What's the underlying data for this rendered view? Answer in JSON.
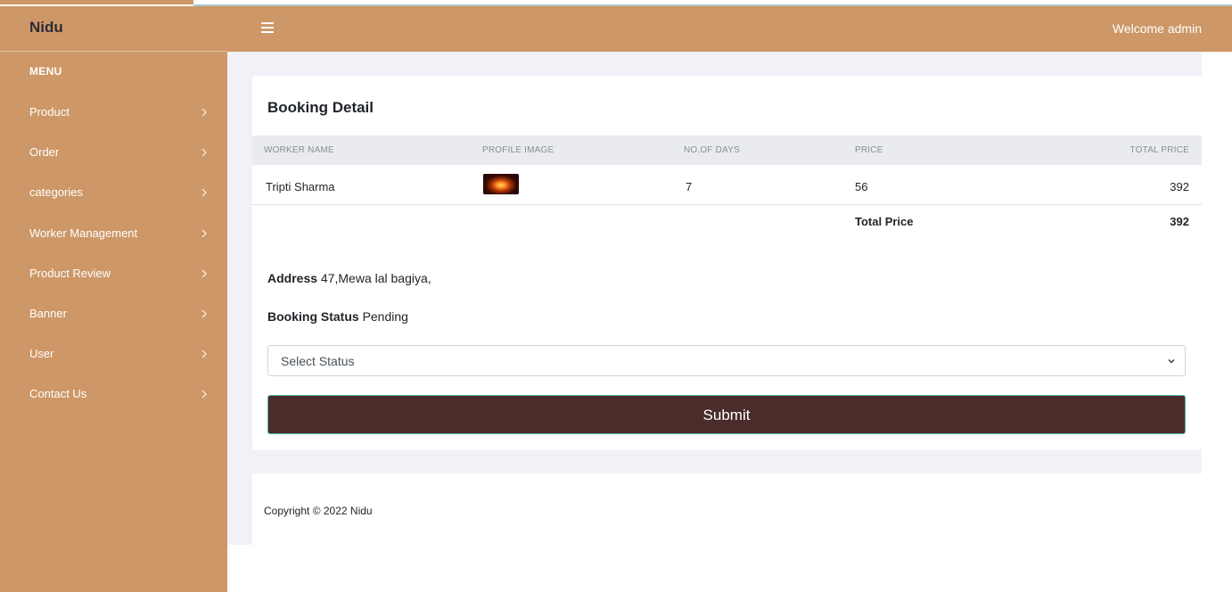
{
  "header": {
    "brand": "Nidu",
    "welcome": "Welcome admin"
  },
  "sidebar": {
    "menu_title": "MENU",
    "items": [
      {
        "label": "Product"
      },
      {
        "label": "Order"
      },
      {
        "label": "categories"
      },
      {
        "label": "Worker Management"
      },
      {
        "label": "Product Review"
      },
      {
        "label": "Banner"
      },
      {
        "label": "User"
      },
      {
        "label": "Contact Us"
      }
    ]
  },
  "booking": {
    "title": "Booking Detail",
    "columns": [
      "WORKER NAME",
      "PROFILE IMAGE",
      "NO.OF DAYS",
      "PRICE",
      "TOTAL PRICE"
    ],
    "rows": [
      {
        "worker_name": "Tripti Sharma",
        "profile_image": "profile-thumbnail",
        "days": "7",
        "price": "56",
        "total_price": "392"
      }
    ],
    "total_label": "Total Price",
    "total_value": "392",
    "address_label": "Address",
    "address_value": "47,Mewa lal bagiya,",
    "status_label": "Booking Status",
    "status_value": "Pending",
    "select_value": "Select Status",
    "submit_label": "Submit"
  },
  "footer": {
    "copyright": "Copyright © 2022 Nidu"
  },
  "colors": {
    "sidebar": "#cd9767",
    "submit_bg": "#4a2c2a",
    "content_bg": "#f1f2f7"
  },
  "icons": {
    "menu_toggle": "hamburger-icon",
    "menu_chevron": "chevron-right-icon",
    "select_arrow": "chevron-down-icon"
  }
}
